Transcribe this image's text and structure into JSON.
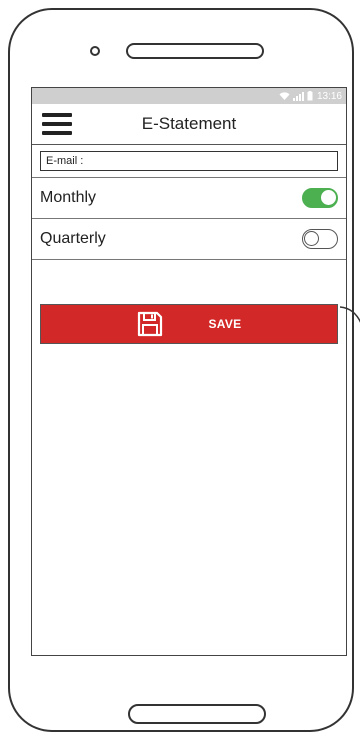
{
  "status_bar": {
    "time": "13:16"
  },
  "header": {
    "title": "E-Statement"
  },
  "form": {
    "email_placeholder": "E-mail :",
    "options": [
      {
        "label": "Monthly",
        "enabled": true
      },
      {
        "label": "Quarterly",
        "enabled": false
      }
    ],
    "save_label": "SAVE"
  },
  "colors": {
    "accent": "#d32828",
    "toggle_on": "#4caf50",
    "statusbar": "#cfcfcf"
  },
  "icons": [
    "menu-icon",
    "wifi-icon",
    "signal-icon",
    "battery-icon",
    "save-icon"
  ]
}
